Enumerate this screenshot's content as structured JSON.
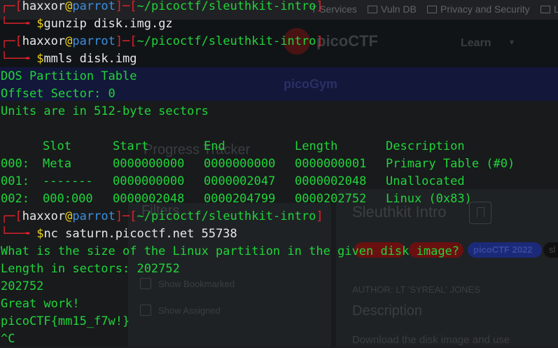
{
  "browser": {
    "bookmarks": [
      "T Services",
      "Vuln DB",
      "Privacy and Security",
      "Li"
    ],
    "logo_text": "picoCTF",
    "nav_learn": "Learn",
    "subnav_title": "picoGym",
    "progress_tracker": "Progress Tracker",
    "filters_title": "Filters",
    "filter_options": [
      "Show Bookmarked",
      "Show Assigned"
    ],
    "challenge": {
      "title": "Sleuthkit Intro",
      "tags": [
        "",
        "",
        "picoCTF 2022",
        "sl"
      ],
      "author": "AUTHOR: LT 'SYREAL' JONES",
      "description_heading": "Description",
      "description_text": "Download the disk image and use"
    }
  },
  "terminal": {
    "prompt": {
      "user": "haxxor",
      "host": "parrot",
      "path": "~/picoctf/sleuthkit-intro"
    },
    "commands": [
      "gunzip disk.img.gz",
      "mmls disk.img",
      "nc saturn.picoctf.net 55738"
    ],
    "mmls": {
      "header": [
        "DOS Partition Table",
        "Offset Sector: 0",
        "Units are in 512-byte sectors"
      ],
      "columns": [
        "Slot",
        "Start",
        "End",
        "Length",
        "Description"
      ],
      "rows": [
        {
          "idx": "000:",
          "slot": "Meta",
          "start": "0000000000",
          "end": "0000000000",
          "length": "0000000001",
          "desc": "Primary Table (#0)"
        },
        {
          "idx": "001:",
          "slot": "-------",
          "start": "0000000000",
          "end": "0000002047",
          "length": "0000002048",
          "desc": "Unallocated"
        },
        {
          "idx": "002:",
          "slot": "000:000",
          "start": "0000002048",
          "end": "0000204799",
          "length": "0000202752",
          "desc": "Linux (0x83)"
        }
      ]
    },
    "nc_output": [
      "What is the size of the Linux partition in the given disk image?",
      "Length in sectors: 202752",
      "202752",
      "Great work!",
      "picoCTF{mm15_f7w!}",
      "^C"
    ]
  },
  "colors": {
    "terminal_green": "#21d43a",
    "prompt_red": "#e0242c",
    "host_blue": "#3c8fe0",
    "dollar_yellow": "#ecd21c"
  }
}
